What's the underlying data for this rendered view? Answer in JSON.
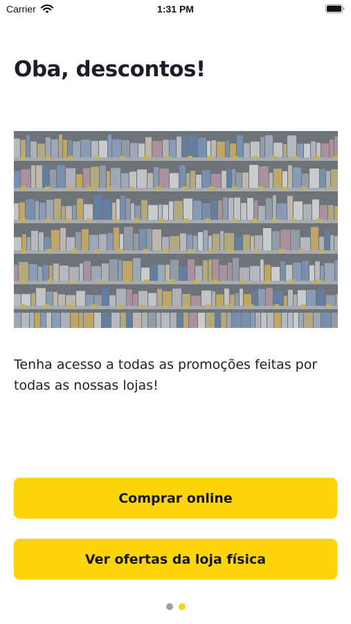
{
  "status_bar": {
    "carrier": "Carrier",
    "time": "1:31 PM",
    "icons": [
      "wifi-icon",
      "battery-icon"
    ]
  },
  "onboarding": {
    "title": "Oba, descontos!",
    "image": "supermarket-shelves-image",
    "description": "Tenha acesso a todas as promoções feitas por todas as nossas lojas!",
    "buttons": {
      "buy_online": "Comprar online",
      "store_offers": "Ver ofertas da loja física"
    },
    "pagination": {
      "total_pages": 2,
      "current_page": 2
    }
  },
  "colors": {
    "accent": "#fdd50a",
    "title_text": "#1c1c2b",
    "dot_inactive": "#9a9fa6",
    "dot_active": "#fdd50a"
  }
}
